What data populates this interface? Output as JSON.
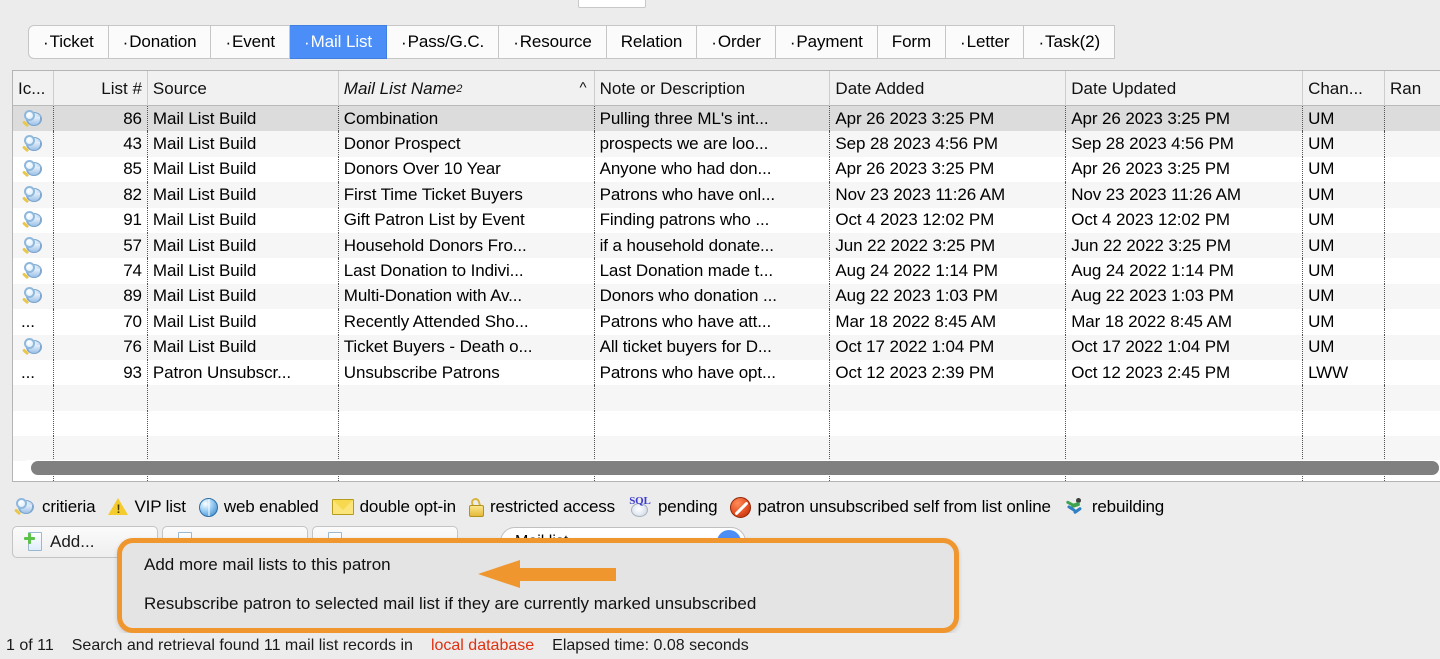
{
  "tabs": [
    {
      "label": "Ticket",
      "bullet": true,
      "active": false
    },
    {
      "label": "Donation",
      "bullet": true,
      "active": false
    },
    {
      "label": "Event",
      "bullet": true,
      "active": false
    },
    {
      "label": "Mail List",
      "bullet": true,
      "active": true
    },
    {
      "label": "Pass/G.C.",
      "bullet": true,
      "active": false
    },
    {
      "label": "Resource",
      "bullet": true,
      "active": false
    },
    {
      "label": "Relation",
      "bullet": false,
      "active": false
    },
    {
      "label": "Order",
      "bullet": true,
      "active": false
    },
    {
      "label": "Payment",
      "bullet": true,
      "active": false
    },
    {
      "label": "Form",
      "bullet": false,
      "active": false
    },
    {
      "label": "Letter",
      "bullet": true,
      "active": false
    },
    {
      "label": "Task(2)",
      "bullet": true,
      "active": false
    }
  ],
  "table": {
    "columns": [
      {
        "key": "icon",
        "label": "Ic...",
        "align": "left"
      },
      {
        "key": "list",
        "label": "List #",
        "align": "right"
      },
      {
        "key": "src",
        "label": "Source",
        "align": "left"
      },
      {
        "key": "name",
        "label": "Mail List Name",
        "align": "left",
        "superscript": "2",
        "sorted": true,
        "sort_caret": "^"
      },
      {
        "key": "note",
        "label": "Note or Description",
        "align": "left"
      },
      {
        "key": "dadd",
        "label": "Date Added",
        "align": "left"
      },
      {
        "key": "dupd",
        "label": "Date Updated",
        "align": "left"
      },
      {
        "key": "chan",
        "label": "Chan...",
        "align": "left"
      },
      {
        "key": "ran",
        "label": "Ran",
        "align": "left"
      }
    ],
    "rows": [
      {
        "icon": "criteria-icon",
        "list": "86",
        "src": "Mail List Build",
        "name": "Combination",
        "note": "Pulling three ML's int...",
        "dadd": "Apr 26 2023 3:25 PM",
        "dupd": "Apr 26 2023 3:25 PM",
        "chan": "UM",
        "selected": true
      },
      {
        "icon": "criteria-icon",
        "list": "43",
        "src": "Mail List Build",
        "name": "Donor Prospect",
        "note": "prospects we are loo...",
        "dadd": "Sep 28 2023 4:56 PM",
        "dupd": "Sep 28 2023 4:56 PM",
        "chan": "UM"
      },
      {
        "icon": "criteria-icon",
        "list": "85",
        "src": "Mail List Build",
        "name": "Donors Over 10 Year",
        "note": "Anyone who had don...",
        "dadd": "Apr 26 2023 3:25 PM",
        "dupd": "Apr 26 2023 3:25 PM",
        "chan": "UM"
      },
      {
        "icon": "criteria-icon",
        "list": "82",
        "src": "Mail List Build",
        "name": "First Time Ticket Buyers",
        "note": "Patrons who have onl...",
        "dadd": "Nov 23 2023 11:26 AM",
        "dupd": "Nov 23 2023 11:26 AM",
        "chan": "UM"
      },
      {
        "icon": "criteria-icon",
        "list": "91",
        "src": "Mail List Build",
        "name": "Gift Patron List by Event",
        "note": "Finding patrons who ...",
        "dadd": "Oct 4 2023 12:02 PM",
        "dupd": "Oct 4 2023 12:02 PM",
        "chan": "UM"
      },
      {
        "icon": "criteria-icon",
        "list": "57",
        "src": "Mail List Build",
        "name": "Household Donors Fro...",
        "note": "if a household donate...",
        "dadd": "Jun 22 2022 3:25 PM",
        "dupd": "Jun 22 2022 3:25 PM",
        "chan": "UM"
      },
      {
        "icon": "criteria-icon",
        "list": "74",
        "src": "Mail List Build",
        "name": "Last Donation to Indivi...",
        "note": "Last Donation made t...",
        "dadd": "Aug 24 2022 1:14 PM",
        "dupd": "Aug 24 2022 1:14 PM",
        "chan": "UM"
      },
      {
        "icon": "criteria-icon",
        "list": "89",
        "src": "Mail List Build",
        "name": "Multi-Donation with Av...",
        "note": "Donors who donation ...",
        "dadd": "Aug 22 2023 1:03 PM",
        "dupd": "Aug 22 2023 1:03 PM",
        "chan": "UM"
      },
      {
        "icon": "ellipsis",
        "list": "70",
        "src": "Mail List Build",
        "name": "Recently Attended Sho...",
        "note": "Patrons who have att...",
        "dadd": "Mar 18 2022 8:45 AM",
        "dupd": "Mar 18 2022 8:45 AM",
        "chan": "UM"
      },
      {
        "icon": "criteria-icon",
        "list": "76",
        "src": "Mail List Build",
        "name": "Ticket Buyers - Death o...",
        "note": "All ticket buyers for D...",
        "dadd": "Oct 17 2022 1:04 PM",
        "dupd": "Oct 17 2022 1:04 PM",
        "chan": "UM"
      },
      {
        "icon": "ellipsis",
        "list": "93",
        "src": "Patron Unsubscr...",
        "name": "Unsubscribe Patrons",
        "note": "Patrons who have opt...",
        "dadd": "Oct 12 2023 2:39 PM",
        "dupd": "Oct 12 2023 2:45 PM",
        "chan": "LWW"
      }
    ],
    "ellipsis_glyph": "..."
  },
  "legend": [
    {
      "icon": "criteria-icon",
      "label": "critieria"
    },
    {
      "icon": "warning-icon",
      "label": "VIP list"
    },
    {
      "icon": "globe-icon",
      "label": "web enabled"
    },
    {
      "icon": "envelope-icon",
      "label": "double opt-in"
    },
    {
      "icon": "lock-icon",
      "label": "restricted access"
    },
    {
      "icon": "sql-disc-icon",
      "label": "pending"
    },
    {
      "icon": "no-entry-icon",
      "label": "patron unsubscribed self from list online"
    },
    {
      "icon": "runner-icon",
      "label": "rebuilding"
    }
  ],
  "toolbar": {
    "add_button": "Add...",
    "button2": "",
    "button3": "",
    "search_value": "Mail list...",
    "search_go": "▶"
  },
  "callout": {
    "line1": "Add more mail lists to this patron",
    "line2": "Resubscribe patron to selected mail list if they are currently marked unsubscribed",
    "border_color": "#f0962f"
  },
  "statusbar": {
    "position": "1 of 11",
    "message_pre": "Search and retrieval found 11 mail list records in",
    "source": "local database",
    "elapsed": "Elapsed time: 0.08 seconds"
  }
}
